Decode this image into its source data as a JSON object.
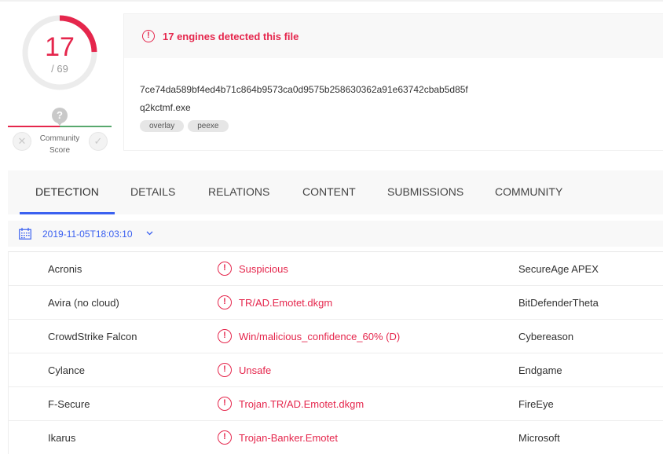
{
  "colors": {
    "malicious": "#e5264c",
    "accent": "#3b61f0",
    "positive": "#58a86e"
  },
  "score": {
    "detected": "17",
    "total": "/ 69",
    "detected_fraction": 0.246
  },
  "community": {
    "question_icon": "?",
    "label_line1": "Community",
    "label_line2": "Score"
  },
  "header": {
    "alert_text": "17 engines detected this file",
    "hash": "7ce74da589bf4ed4b71c864b9573ca0d9575b258630362a91e63742cbab5d85f",
    "filename": "q2kctmf.exe",
    "tags": [
      "overlay",
      "peexe"
    ]
  },
  "tabs": [
    "DETECTION",
    "DETAILS",
    "RELATIONS",
    "CONTENT",
    "SUBMISSIONS",
    "COMMUNITY"
  ],
  "active_tab": "DETECTION",
  "analysis_date": "2019-11-05T18:03:10",
  "detections": [
    {
      "engine": "Acronis",
      "result": "Suspicious",
      "engine2": "SecureAge APEX"
    },
    {
      "engine": "Avira (no cloud)",
      "result": "TR/AD.Emotet.dkgm",
      "engine2": "BitDefenderTheta"
    },
    {
      "engine": "CrowdStrike Falcon",
      "result": "Win/malicious_confidence_60% (D)",
      "engine2": "Cybereason"
    },
    {
      "engine": "Cylance",
      "result": "Unsafe",
      "engine2": "Endgame"
    },
    {
      "engine": "F-Secure",
      "result": "Trojan.TR/AD.Emotet.dkgm",
      "engine2": "FireEye"
    },
    {
      "engine": "Ikarus",
      "result": "Trojan-Banker.Emotet",
      "engine2": "Microsoft"
    }
  ]
}
